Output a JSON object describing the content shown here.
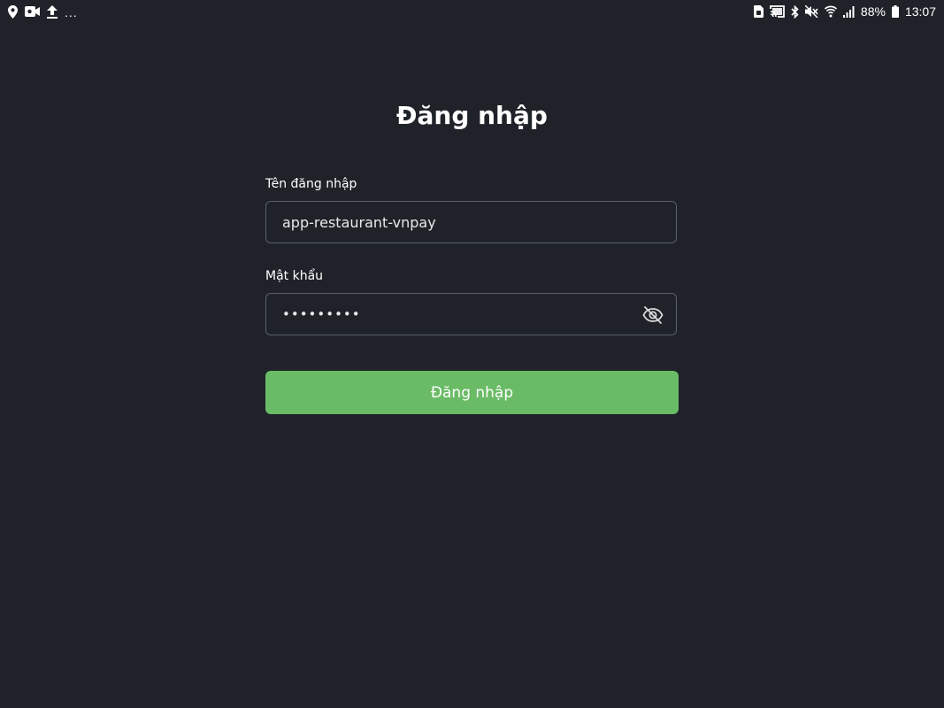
{
  "status_bar": {
    "left_icons": [
      "location-pin-icon",
      "video-camera-icon",
      "upload-icon"
    ],
    "overflow": "...",
    "right_icons": [
      "sim-card-icon",
      "cast-icon",
      "bluetooth-icon",
      "mute-icon",
      "wifi-icon",
      "signal-icon",
      "battery-icon"
    ],
    "battery_percent": "88%",
    "time": "13:07"
  },
  "login": {
    "title": "Đăng nhập",
    "username": {
      "label": "Tên đăng nhập",
      "value": "app-restaurant-vnpay"
    },
    "password": {
      "label": "Mật khẩu",
      "value": "•••••••••",
      "toggle_icon": "eye-off-icon"
    },
    "submit_label": "Đăng nhập"
  },
  "colors": {
    "background": "#1f2329",
    "input_border": "#5a5f69",
    "button": "#6abb65",
    "text": "#ffffff"
  }
}
